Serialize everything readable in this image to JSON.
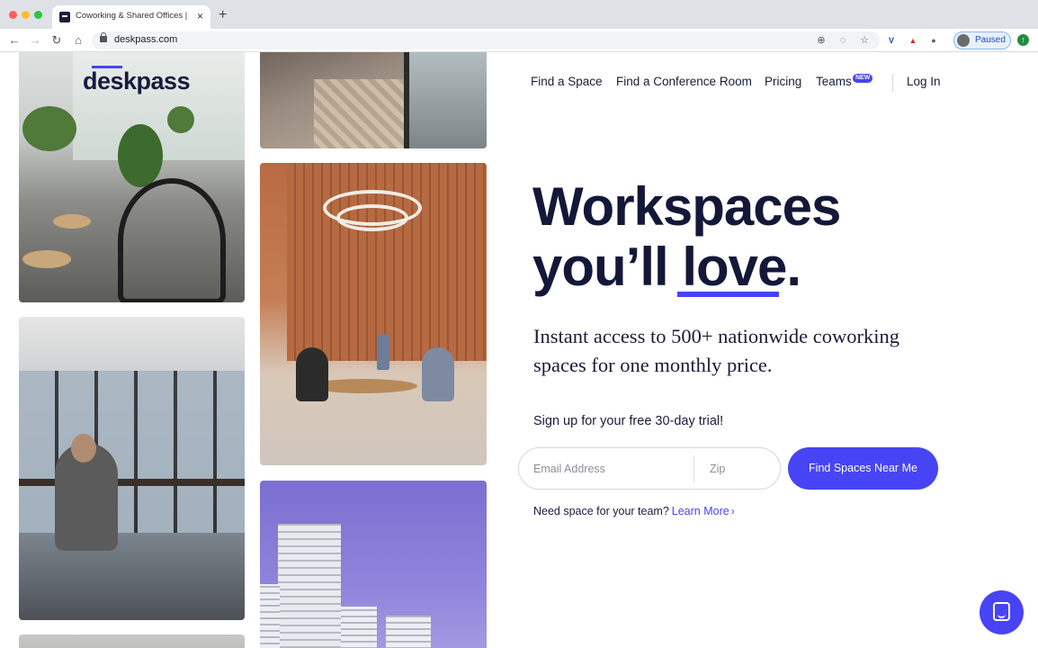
{
  "browser": {
    "tab_title": "Coworking & Shared Offices | D",
    "tab_close": "×",
    "new_tab": "+",
    "url": "deskpass.com",
    "nav": {
      "back": "←",
      "forward": "→",
      "reload": "↻",
      "home": "⌂"
    },
    "omnibox_icons": {
      "zoom": "⊕",
      "eye_off": "◌",
      "bookmark": "☆"
    },
    "profile_label": "Paused",
    "extensions": [
      {
        "name": "v-extension-icon",
        "glyph": "V",
        "color": "#1a4fb4"
      },
      {
        "name": "red-extension-icon",
        "glyph": "▲",
        "color": "#d93025"
      },
      {
        "name": "gray-extension-icon",
        "glyph": "●",
        "color": "#5f6368"
      }
    ],
    "update_glyph": "↑"
  },
  "site": {
    "logo": "deskpass",
    "nav": {
      "find_space": "Find a Space",
      "conference_room": "Find a Conference Room",
      "pricing": "Pricing",
      "teams": "Teams",
      "teams_badge": "NEW",
      "login": "Log In"
    },
    "hero": {
      "line1": "Workspaces",
      "line2_prefix": "you’ll ",
      "line2_highlight": "love",
      "line2_suffix": ".",
      "subtitle": "Instant access to 500+ nationwide coworking spaces for one monthly price."
    },
    "signup": {
      "heading": "Sign up for your free 30-day trial!",
      "email_placeholder": "Email Address",
      "zip_placeholder": "Zip",
      "cta": "Find Spaces Near Me",
      "team_prompt": "Need space for your team?",
      "learn_more": "Learn More",
      "learn_more_chevron": "›"
    }
  },
  "colors": {
    "brand": "#4744f6",
    "heading": "#141838",
    "text": "#1a1c3a"
  }
}
